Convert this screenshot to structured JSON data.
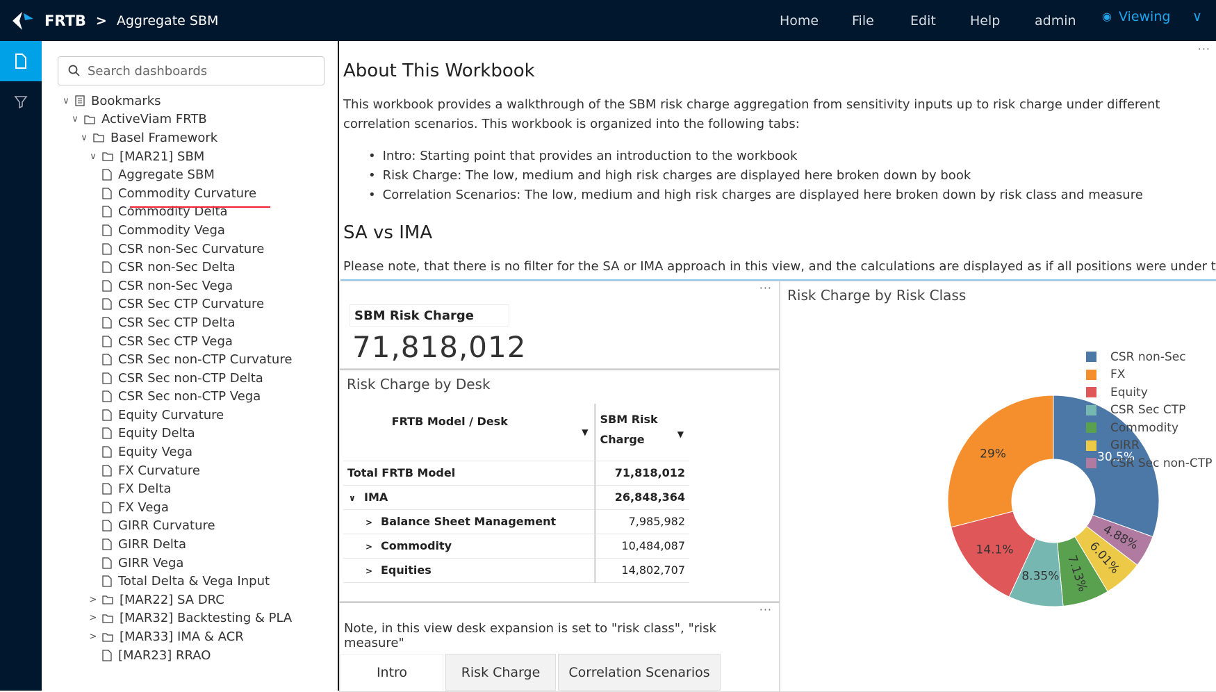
{
  "header": {
    "brand": "FRTB",
    "separator": ">",
    "breadcrumb": "Aggregate SBM",
    "menu": [
      "Home",
      "File",
      "Edit",
      "Help",
      "admin"
    ],
    "mode": "Viewing"
  },
  "sidebar": {
    "search_placeholder": "Search dashboards",
    "tree": [
      {
        "label": "Bookmarks",
        "level": 0,
        "type": "bookmarks",
        "expanded": true
      },
      {
        "label": "ActiveViam FRTB",
        "level": 1,
        "type": "folder",
        "expanded": true
      },
      {
        "label": "Basel Framework",
        "level": 2,
        "type": "folder",
        "expanded": true
      },
      {
        "label": "[MAR21] SBM",
        "level": 3,
        "type": "folder",
        "expanded": true
      },
      {
        "label": "Aggregate SBM",
        "level": 4,
        "type": "file"
      },
      {
        "label": "Commodity Curvature",
        "level": 4,
        "type": "file"
      },
      {
        "label": "Commodity Delta",
        "level": 4,
        "type": "file"
      },
      {
        "label": "Commodity Vega",
        "level": 4,
        "type": "file"
      },
      {
        "label": "CSR non-Sec Curvature",
        "level": 4,
        "type": "file"
      },
      {
        "label": "CSR non-Sec Delta",
        "level": 4,
        "type": "file"
      },
      {
        "label": "CSR non-Sec Vega",
        "level": 4,
        "type": "file"
      },
      {
        "label": "CSR Sec CTP Curvature",
        "level": 4,
        "type": "file"
      },
      {
        "label": "CSR Sec CTP Delta",
        "level": 4,
        "type": "file"
      },
      {
        "label": "CSR Sec CTP Vega",
        "level": 4,
        "type": "file"
      },
      {
        "label": "CSR Sec non-CTP Curvature",
        "level": 4,
        "type": "file"
      },
      {
        "label": "CSR Sec non-CTP Delta",
        "level": 4,
        "type": "file"
      },
      {
        "label": "CSR Sec non-CTP Vega",
        "level": 4,
        "type": "file"
      },
      {
        "label": "Equity Curvature",
        "level": 4,
        "type": "file"
      },
      {
        "label": "Equity Delta",
        "level": 4,
        "type": "file"
      },
      {
        "label": "Equity Vega",
        "level": 4,
        "type": "file"
      },
      {
        "label": "FX Curvature",
        "level": 4,
        "type": "file"
      },
      {
        "label": "FX Delta",
        "level": 4,
        "type": "file"
      },
      {
        "label": "FX Vega",
        "level": 4,
        "type": "file"
      },
      {
        "label": "GIRR Curvature",
        "level": 4,
        "type": "file"
      },
      {
        "label": "GIRR Delta",
        "level": 4,
        "type": "file"
      },
      {
        "label": "GIRR Vega",
        "level": 4,
        "type": "file"
      },
      {
        "label": "Total Delta & Vega Input",
        "level": 4,
        "type": "file"
      },
      {
        "label": "[MAR22] SA DRC",
        "level": 3,
        "type": "folder",
        "expanded": false
      },
      {
        "label": "[MAR32] Backtesting & PLA",
        "level": 3,
        "type": "folder",
        "expanded": false
      },
      {
        "label": "[MAR33] IMA & ACR",
        "level": 3,
        "type": "folder",
        "expanded": false
      },
      {
        "label": "[MAR23] RRAO",
        "level": 3,
        "type": "file"
      }
    ]
  },
  "main": {
    "title1": "About This Workbook",
    "intro": "This workbook provides a walkthrough of the SBM risk charge aggregation from sensitivity inputs up to risk charge under different correlation scenarios. This workbook is organized into the following tabs:",
    "bullets": [
      "Intro: Starting point that provides an introduction to the workbook",
      "Risk Charge: The low, medium and high risk charges are displayed here broken down by book",
      "Correlation Scenarios: The low, medium and high risk charges are displayed here broken down by risk class and measure"
    ],
    "title2": "SA vs IMA",
    "note": "Please note, that there is no filter for the SA or IMA approach in this view, and the calculations are displayed as if all positions were under the SA",
    "kpi": {
      "label": "SBM Risk Charge",
      "value": "71,818,012"
    },
    "desk_table": {
      "title": "Risk Charge by Desk",
      "headers": [
        "FRTB Model / Desk",
        "SBM Risk Charge"
      ],
      "rows": [
        {
          "label": "Total FRTB Model",
          "value": "71,818,012",
          "level": 0,
          "bold": true
        },
        {
          "label": "IMA",
          "value": "26,848,364",
          "level": 0,
          "bold": true,
          "expander": "open"
        },
        {
          "label": "Balance Sheet Management",
          "value": "7,985,982",
          "level": 1,
          "expander": "closed"
        },
        {
          "label": "Commodity",
          "value": "10,484,087",
          "level": 1,
          "expander": "closed"
        },
        {
          "label": "Equities",
          "value": "14,802,707",
          "level": 1,
          "expander": "closed"
        }
      ]
    },
    "footnote": "Note, in this view desk expansion is set to \"risk class\", \"risk measure\"",
    "tabs": [
      {
        "label": "Intro",
        "active": true
      },
      {
        "label": "Risk Charge",
        "active": false
      },
      {
        "label": "Correlation Scenarios",
        "active": false
      }
    ]
  },
  "chart_data": {
    "type": "pie",
    "hole": true,
    "title": "Risk Charge by Risk Class",
    "legend_position": "right",
    "legend": [
      "CSR non-Sec",
      "FX",
      "Equity",
      "CSR Sec CTP",
      "Commodity",
      "GIRR",
      "CSR Sec non-CTP"
    ],
    "colors": {
      "CSR non-Sec": "#4c78a8",
      "FX": "#f58f2e",
      "Equity": "#e05759",
      "CSR Sec CTP": "#76b7b2",
      "Commodity": "#59a14f",
      "GIRR": "#edc948",
      "CSR Sec non-CTP": "#b07aa1"
    },
    "slices": [
      {
        "label": "CSR non-Sec",
        "value": 30.5,
        "text": "30.5%"
      },
      {
        "label": "CSR Sec non-CTP",
        "value": 4.88,
        "text": "4.88%"
      },
      {
        "label": "GIRR",
        "value": 6.01,
        "text": "6.01%"
      },
      {
        "label": "Commodity",
        "value": 7.13,
        "text": "7.13%"
      },
      {
        "label": "CSR Sec CTP",
        "value": 8.35,
        "text": "8.35%"
      },
      {
        "label": "Equity",
        "value": 14.1,
        "text": "14.1%"
      },
      {
        "label": "FX",
        "value": 29,
        "text": "29%"
      }
    ]
  }
}
